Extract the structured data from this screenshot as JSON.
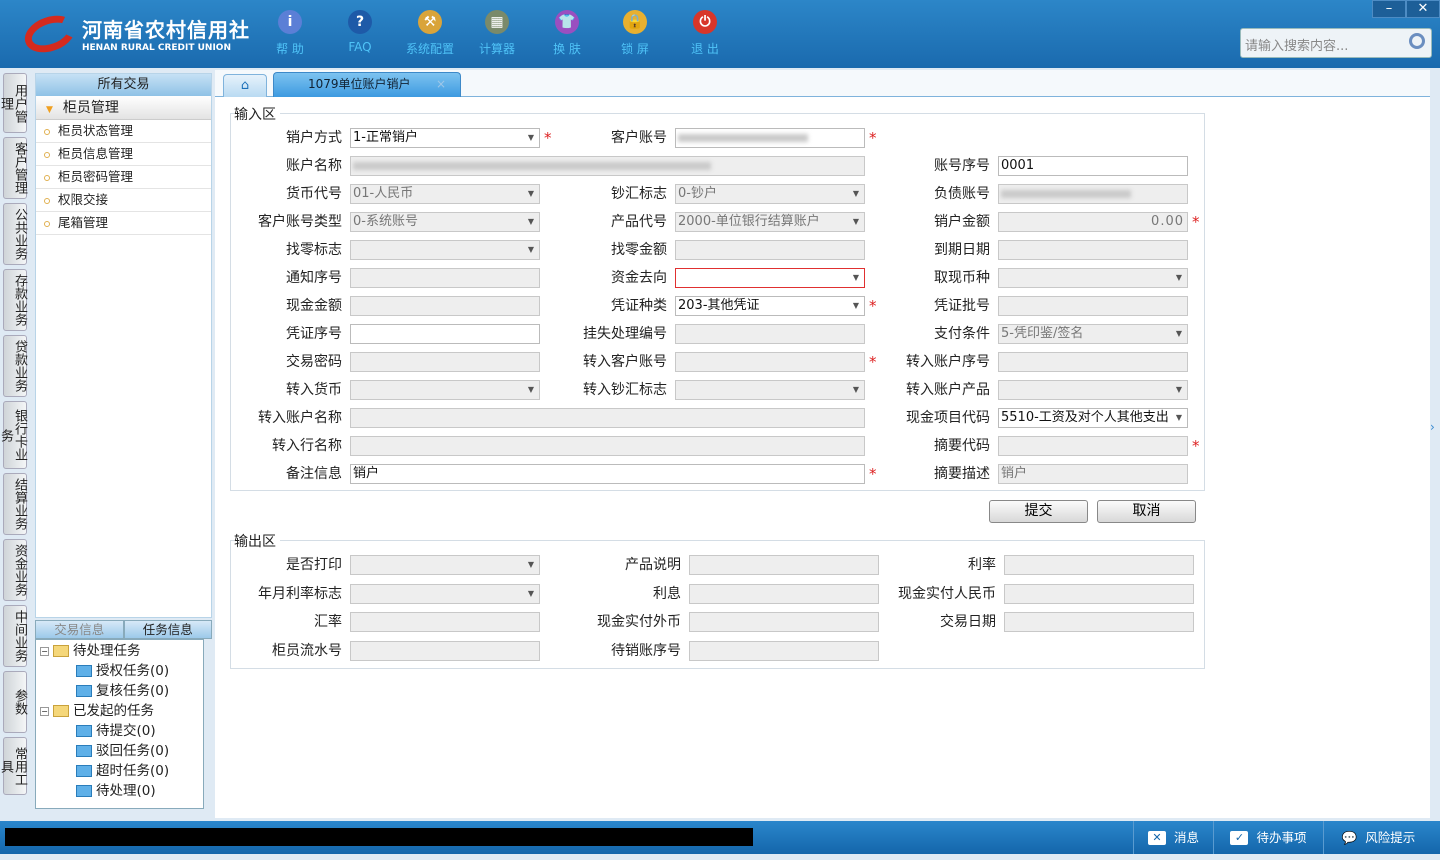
{
  "header": {
    "logo_cn": "河南省农村信用社",
    "logo_en": "HENAN RURAL CREDIT UNION",
    "tools": [
      {
        "label": "帮 助",
        "icon": "info-icon",
        "glyph": "i",
        "color": "#5b7fd6"
      },
      {
        "label": "FAQ",
        "icon": "help-icon",
        "glyph": "?",
        "color": "#1e5aa8"
      },
      {
        "label": "系统配置",
        "icon": "toolbox-icon",
        "glyph": "⚒",
        "color": "#d9a43a"
      },
      {
        "label": "计算器",
        "icon": "calculator-icon",
        "glyph": "▦",
        "color": "#7a8a6a"
      },
      {
        "label": "换 肤",
        "icon": "shirt-icon",
        "glyph": "👕",
        "color": "#9a4fc0"
      },
      {
        "label": "锁 屏",
        "icon": "lock-icon",
        "glyph": "🔒",
        "color": "#e8b030"
      },
      {
        "label": "退 出",
        "icon": "power-icon",
        "glyph": "⏻",
        "color": "#d8362a"
      }
    ],
    "minimize": "–",
    "close": "✕",
    "search_placeholder": "请输入搜索内容..."
  },
  "vtabs": [
    "用户管理",
    "客户管理",
    "公共业务",
    "存款业务",
    "贷款业务",
    "银行卡业务",
    "结算业务",
    "资金业务",
    "中间业务",
    "参数",
    "常用工具"
  ],
  "nav": {
    "title": "所有交易",
    "group": "柜员管理",
    "items": [
      "柜员状态管理",
      "柜员信息管理",
      "柜员密码管理",
      "权限交接",
      "尾箱管理"
    ]
  },
  "tree": {
    "tabs": [
      "交易信息",
      "任务信息"
    ],
    "nodes": [
      {
        "label": "待处理任务",
        "level": 0,
        "toggle": "−"
      },
      {
        "label": "授权任务(0)",
        "level": 1
      },
      {
        "label": "复核任务(0)",
        "level": 1
      },
      {
        "label": "已发起的任务",
        "level": 0,
        "toggle": "−"
      },
      {
        "label": "待提交(0)",
        "level": 1
      },
      {
        "label": "驳回任务(0)",
        "level": 1
      },
      {
        "label": "超时任务(0)",
        "level": 1
      },
      {
        "label": "待处理(0)",
        "level": 1
      }
    ]
  },
  "tabs": {
    "active": "1079单位账户销户",
    "close": "×"
  },
  "input_section": {
    "title": "输入区",
    "rows": [
      [
        {
          "label": "销户方式",
          "value": "1-正常销户",
          "kind": "select",
          "state": "ed",
          "required": true
        },
        {
          "label": "客户账号",
          "kind": "text",
          "state": "ed",
          "blurred": true,
          "required": true
        },
        null
      ],
      [
        {
          "label": "账户名称",
          "kind": "text",
          "state": "ro",
          "blurred": true,
          "wide": true
        },
        null,
        {
          "label": "账号序号",
          "value": "0001",
          "kind": "text",
          "state": "ed"
        }
      ],
      [
        {
          "label": "货币代号",
          "value": "01-人民币",
          "kind": "select",
          "state": "ro"
        },
        {
          "label": "钞汇标志",
          "value": "0-钞户",
          "kind": "select",
          "state": "ro"
        },
        {
          "label": "负债账号",
          "kind": "text",
          "state": "ro",
          "blurred": true
        }
      ],
      [
        {
          "label": "客户账号类型",
          "value": "0-系统账号",
          "kind": "select",
          "state": "ro"
        },
        {
          "label": "产品代号",
          "value": "2000-单位银行结算账户",
          "kind": "select",
          "state": "ro"
        },
        {
          "label": "销户金额",
          "value": "0.00",
          "kind": "text",
          "state": "ro",
          "numeric": true,
          "required": true
        }
      ],
      [
        {
          "label": "找零标志",
          "kind": "select",
          "state": "ro"
        },
        {
          "label": "找零金额",
          "kind": "text",
          "state": "ro"
        },
        {
          "label": "到期日期",
          "kind": "text",
          "state": "ro"
        }
      ],
      [
        {
          "label": "通知序号",
          "kind": "text",
          "state": "ro"
        },
        {
          "label": "资金去向",
          "kind": "select",
          "state": "err"
        },
        {
          "label": "取现币种",
          "kind": "select",
          "state": "ro"
        }
      ],
      [
        {
          "label": "现金金额",
          "kind": "text",
          "state": "ro"
        },
        {
          "label": "凭证种类",
          "value": "203-其他凭证",
          "kind": "select",
          "state": "ed",
          "required": true
        },
        {
          "label": "凭证批号",
          "kind": "text",
          "state": "ro"
        }
      ],
      [
        {
          "label": "凭证序号",
          "kind": "text",
          "state": "ed"
        },
        {
          "label": "挂失处理编号",
          "kind": "text",
          "state": "ro"
        },
        {
          "label": "支付条件",
          "value": "5-凭印鉴/签名",
          "kind": "select",
          "state": "ro"
        }
      ],
      [
        {
          "label": "交易密码",
          "kind": "text",
          "state": "ro"
        },
        {
          "label": "转入客户账号",
          "kind": "text",
          "state": "ro",
          "required": true
        },
        {
          "label": "转入账户序号",
          "kind": "text",
          "state": "ro"
        }
      ],
      [
        {
          "label": "转入货币",
          "kind": "select",
          "state": "ro"
        },
        {
          "label": "转入钞汇标志",
          "kind": "select",
          "state": "ro"
        },
        {
          "label": "转入账户产品",
          "kind": "select",
          "state": "ro"
        }
      ],
      [
        {
          "label": "转入账户名称",
          "kind": "text",
          "state": "ro",
          "wide": true
        },
        null,
        {
          "label": "现金项目代码",
          "value": "5510-工资及对个人其他支出",
          "kind": "select",
          "state": "ed"
        }
      ],
      [
        {
          "label": "转入行名称",
          "kind": "text",
          "state": "ro",
          "wide": true
        },
        null,
        {
          "label": "摘要代码",
          "kind": "text",
          "state": "ro",
          "required": true
        }
      ],
      [
        {
          "label": "备注信息",
          "value": "销户",
          "kind": "text",
          "state": "ed",
          "wide": true,
          "required": true
        },
        null,
        {
          "label": "摘要描述",
          "value": "销户",
          "kind": "text",
          "state": "ro"
        }
      ]
    ]
  },
  "buttons": {
    "submit": "提交",
    "cancel": "取消"
  },
  "output_section": {
    "title": "输出区",
    "rows": [
      [
        {
          "label": "是否打印",
          "kind": "select",
          "state": "ro"
        },
        {
          "label": "产品说明",
          "kind": "text",
          "state": "ro"
        },
        {
          "label": "利率",
          "kind": "text",
          "state": "ro"
        }
      ],
      [
        {
          "label": "年月利率标志",
          "kind": "select",
          "state": "ro"
        },
        {
          "label": "利息",
          "kind": "text",
          "state": "ro"
        },
        {
          "label": "现金实付人民币",
          "kind": "text",
          "state": "ro"
        }
      ],
      [
        {
          "label": "汇率",
          "kind": "text",
          "state": "ro"
        },
        {
          "label": "现金实付外币",
          "kind": "text",
          "state": "ro"
        },
        {
          "label": "交易日期",
          "kind": "text",
          "state": "ro"
        }
      ],
      [
        {
          "label": "柜员流水号",
          "kind": "text",
          "state": "ro"
        },
        {
          "label": "待销账序号",
          "kind": "text",
          "state": "ro"
        },
        null
      ]
    ]
  },
  "status": {
    "messages": "消息",
    "todo": "待办事项",
    "risk": "风险提示"
  }
}
